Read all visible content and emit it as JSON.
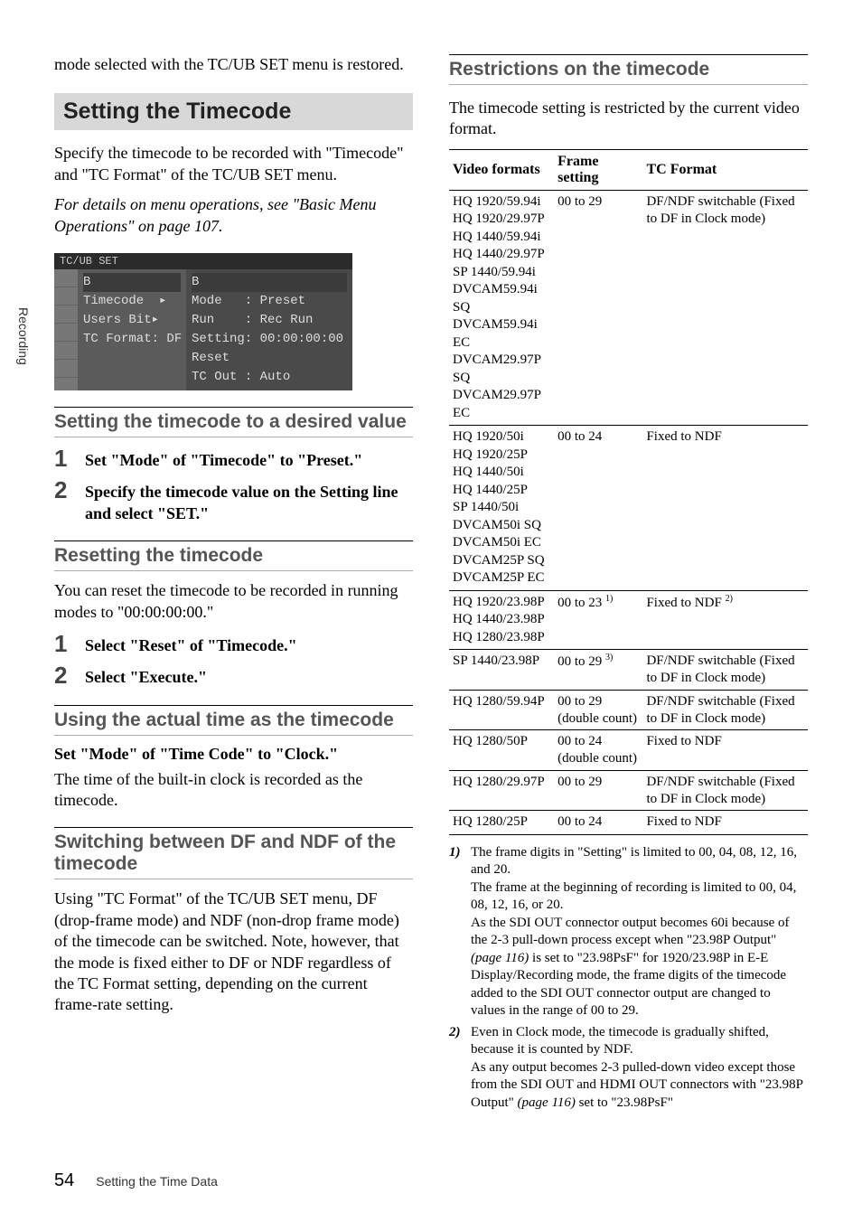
{
  "sideTab": "Recording",
  "left": {
    "intro": "mode selected with the TC/UB SET menu is restored.",
    "mainHeading": "Setting the Timecode",
    "leadIn": "Specify the timecode to be recorded with \"Timecode\" and \"TC Format\" of the TC/UB SET menu.",
    "refNote": "For details on menu operations, see \"Basic Menu Operations\" on page 107.",
    "menu": {
      "title": "TC/UB SET",
      "left": [
        "B",
        "Timecode  ▸",
        "Users Bit▸",
        "TC Format: DF"
      ],
      "right": [
        "B",
        "Mode   : Preset",
        "Run    : Rec Run",
        "Setting: 00:00:00:00",
        "Reset",
        "TC Out : Auto"
      ]
    },
    "sub1": "Setting the timecode to a desired value",
    "steps1": [
      "Set \"Mode\" of \"Timecode\" to \"Preset.\"",
      "Specify the timecode value on the Setting line and select \"SET.\""
    ],
    "sub2": "Resetting the timecode",
    "resetText": "You can reset the timecode to be recorded in running modes to \"00:00:00:00.\"",
    "steps2": [
      "Select \"Reset\" of \"Timecode.\"",
      "Select \"Execute.\""
    ],
    "sub3": "Using the actual time as the timecode",
    "clockBold": "Set \"Mode\" of \"Time Code\" to \"Clock.\"",
    "clockText": "The time of the built-in clock is recorded as the timecode.",
    "sub4": "Switching between DF and NDF of the timecode",
    "dfText": "Using \"TC Format\" of the TC/UB SET menu, DF (drop-frame mode) and NDF (non-drop frame mode) of the timecode can be switched. Note, however, that the mode is fixed either to DF or NDF regardless of the TC Format setting, depending on the current frame-rate setting."
  },
  "right": {
    "heading": "Restrictions on the timecode",
    "intro": "The timecode setting is restricted by the current video format.",
    "headers": [
      "Video formats",
      "Frame setting",
      "TC Format"
    ],
    "rows": [
      {
        "formats": [
          "HQ 1920/59.94i",
          "HQ 1920/29.97P",
          "HQ 1440/59.94i",
          "HQ 1440/29.97P",
          "SP 1440/59.94i",
          "DVCAM59.94i SQ",
          "DVCAM59.94i EC",
          "DVCAM29.97P SQ",
          "DVCAM29.97P EC"
        ],
        "frame": "00 to 29",
        "tc": "DF/NDF switchable (Fixed to DF in Clock mode)"
      },
      {
        "formats": [
          "HQ 1920/50i",
          "HQ 1920/25P",
          "HQ 1440/50i",
          "HQ 1440/25P",
          "SP 1440/50i",
          "DVCAM50i SQ",
          "DVCAM50i EC",
          "DVCAM25P SQ",
          "DVCAM25P EC"
        ],
        "frame": "00 to 24",
        "tc": "Fixed to NDF"
      },
      {
        "formats": [
          "HQ 1920/23.98P",
          "HQ 1440/23.98P",
          "HQ 1280/23.98P"
        ],
        "frame": "00 to 23 ",
        "frameSup": "1)",
        "tc": "Fixed to NDF ",
        "tcSup": "2)"
      },
      {
        "formats": [
          "SP 1440/23.98P"
        ],
        "frame": "00 to 29 ",
        "frameSup": "3)",
        "tc": "DF/NDF switchable (Fixed to DF in Clock mode)"
      },
      {
        "formats": [
          "HQ 1280/59.94P"
        ],
        "frame": "00 to 29 (double count)",
        "tc": "DF/NDF switchable (Fixed to DF in Clock mode)"
      },
      {
        "formats": [
          "HQ 1280/50P"
        ],
        "frame": "00 to 24 (double count)",
        "tc": "Fixed to NDF"
      },
      {
        "formats": [
          "HQ 1280/29.97P"
        ],
        "frame": "00 to 29",
        "tc": "DF/NDF switchable (Fixed to DF in Clock mode)"
      },
      {
        "formats": [
          "HQ 1280/25P"
        ],
        "frame": "00 to 24",
        "tc": "Fixed to NDF"
      }
    ],
    "footnotes": [
      {
        "key": "1)",
        "text1": "The frame digits in \"Setting\" is limited to 00, 04, 08, 12, 16, and 20.",
        "text2": "The frame at the beginning of recording is limited to 00, 04, 08, 12, 16, or 20.",
        "text3a": "As the SDI OUT connector output becomes 60i because of the 2-3 pull-down process except when \"23.98P Output\" ",
        "text3i": "(page 116)",
        "text3b": " is set to \"23.98PsF\" for 1920/23.98P in E-E Display/Recording mode, the frame digits of the timecode added to the SDI OUT connector output are changed to values in the range of 00 to 29."
      },
      {
        "key": "2)",
        "text1": "Even in Clock mode, the timecode is gradually shifted, because it is counted by NDF.",
        "text3a": "As any output becomes 2-3 pulled-down video except those from the SDI OUT and HDMI OUT connectors with \"23.98P Output\" ",
        "text3i": "(page 116)",
        "text3b": " set to \"23.98PsF\""
      }
    ]
  },
  "footer": {
    "page": "54",
    "title": "Setting the Time Data"
  }
}
